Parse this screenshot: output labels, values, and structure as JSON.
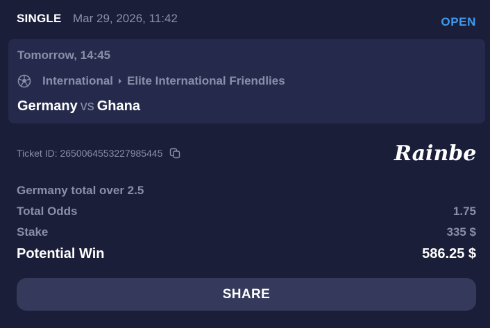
{
  "header": {
    "bet_type": "SINGLE",
    "date": "Mar 29, 2026, 11:42",
    "status": "OPEN"
  },
  "event": {
    "time": "Tomorrow, 14:45",
    "sport_icon": "soccer-ball-icon",
    "category": "International",
    "league": "Elite International Friendlies",
    "home_team": "Germany",
    "vs": "vs",
    "away_team": "Ghana"
  },
  "ticket": {
    "id_text": "Ticket ID: 2650064553227985445",
    "copy_icon": "copy-icon"
  },
  "brand": {
    "logo_text": "Rainbet"
  },
  "selection": "Germany total over 2.5",
  "summary": {
    "total_odds_label": "Total Odds",
    "total_odds_value": "1.75",
    "stake_label": "Stake",
    "stake_value": "335 $",
    "potential_win_label": "Potential Win",
    "potential_win_value": "586.25 $"
  },
  "share_label": "SHARE",
  "colors": {
    "background": "#1b1e38",
    "event_panel": "#252a4c",
    "muted_text": "#8a8ea9",
    "status_blue": "#3d9bf0",
    "button": "#353a5c"
  }
}
